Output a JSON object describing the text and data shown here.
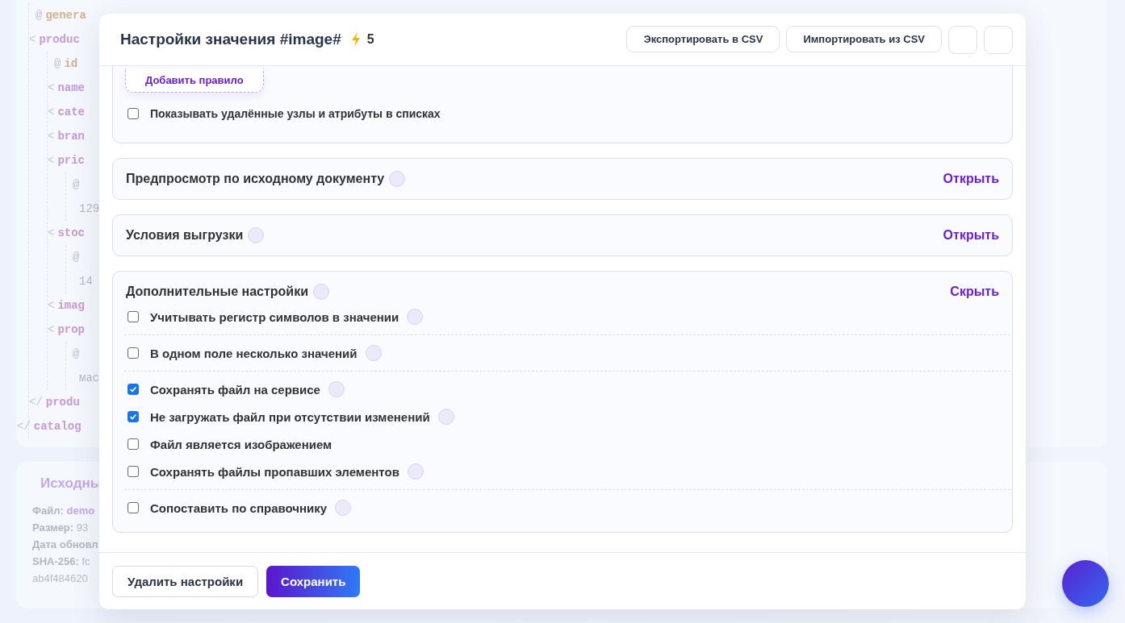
{
  "background": {
    "code_lines": [
      {
        "kind": "attr",
        "sigil": "@",
        "name": "genera"
      },
      {
        "kind": "open",
        "sigil": "<",
        "name": "produc",
        "children": [
          {
            "kind": "attr",
            "sigil": "@",
            "name": "id"
          },
          {
            "kind": "open",
            "sigil": "<",
            "name": "name"
          },
          {
            "kind": "open",
            "sigil": "<",
            "name": "cate"
          },
          {
            "kind": "open",
            "sigil": "<",
            "name": "bran"
          },
          {
            "kind": "open",
            "sigil": "<",
            "name": "pric",
            "children": [
              {
                "kind": "attr",
                "sigil": "@"
              },
              {
                "kind": "text",
                "name": "129"
              }
            ]
          },
          {
            "kind": "open",
            "sigil": "<",
            "name": "stoc",
            "children": [
              {
                "kind": "attr",
                "sigil": "@"
              },
              {
                "kind": "text",
                "name": "14"
              }
            ]
          },
          {
            "kind": "open",
            "sigil": "<",
            "name": "imag"
          },
          {
            "kind": "open",
            "sigil": "<",
            "name": "prop",
            "children": [
              {
                "kind": "attr",
                "sigil": "@"
              },
              {
                "kind": "text",
                "name": "мас"
              }
            ]
          }
        ]
      },
      {
        "kind": "close",
        "sigil": "</",
        "name": "produ"
      },
      {
        "kind": "close",
        "sigil": "</",
        "name": "catalog",
        "outer": true
      }
    ],
    "source_panel": {
      "title": "Исходны",
      "fields": [
        {
          "label": "Файл:",
          "value": "demo",
          "kind": "link"
        },
        {
          "label": "Размер:",
          "value": "93",
          "kind": "plain"
        },
        {
          "label": "Дата обновл"
        },
        {
          "label": "SHA-256:",
          "value": "fc",
          "kind": "plain"
        },
        {
          "value": "ab4f484620",
          "kind": "plain"
        }
      ]
    }
  },
  "modal": {
    "title": "Настройки значения #image#",
    "count": "5",
    "header_buttons": [
      {
        "kind": "text",
        "label": "Экспортировать в CSV"
      },
      {
        "kind": "text",
        "label": "Импортировать из CSV"
      },
      {
        "kind": "blank"
      },
      {
        "kind": "blank"
      }
    ],
    "rules_card": {
      "add_button": "Добавить правило",
      "checkbox": {
        "label": "Показывать удалённые узлы и атрибуты в списках",
        "checked": false
      }
    },
    "sections": [
      {
        "title": "Предпросмотр по исходному документу",
        "help": true,
        "action": "Открыть",
        "expanded": false
      },
      {
        "title": "Условия выгрузки",
        "help": true,
        "action": "Открыть",
        "expanded": false
      },
      {
        "title": "Дополнительные настройки",
        "help": true,
        "action": "Скрыть",
        "expanded": true,
        "groups": [
          {
            "options": [
              {
                "label": "Учитывать регистр символов в значении",
                "checked": false,
                "help": true
              }
            ]
          },
          {
            "options": [
              {
                "label": "В одном поле несколько значений",
                "checked": false,
                "help": true
              }
            ]
          },
          {
            "options": [
              {
                "label": "Сохранять файл на сервисе",
                "checked": true,
                "help": true
              },
              {
                "label": "Не загружать файл при отсутствии изменений",
                "checked": true,
                "help": true
              },
              {
                "label": "Файл является изображением",
                "checked": false,
                "help": false
              },
              {
                "label": "Сохранять файлы пропавших элементов",
                "checked": false,
                "help": true
              }
            ]
          },
          {
            "options": [
              {
                "label": "Сопоставить по справочнику",
                "checked": false,
                "help": true
              }
            ]
          }
        ]
      }
    ],
    "footer_buttons": [
      {
        "kind": "secondary",
        "label": "Удалить настройки"
      },
      {
        "kind": "primary",
        "label": "Сохранить"
      }
    ]
  }
}
